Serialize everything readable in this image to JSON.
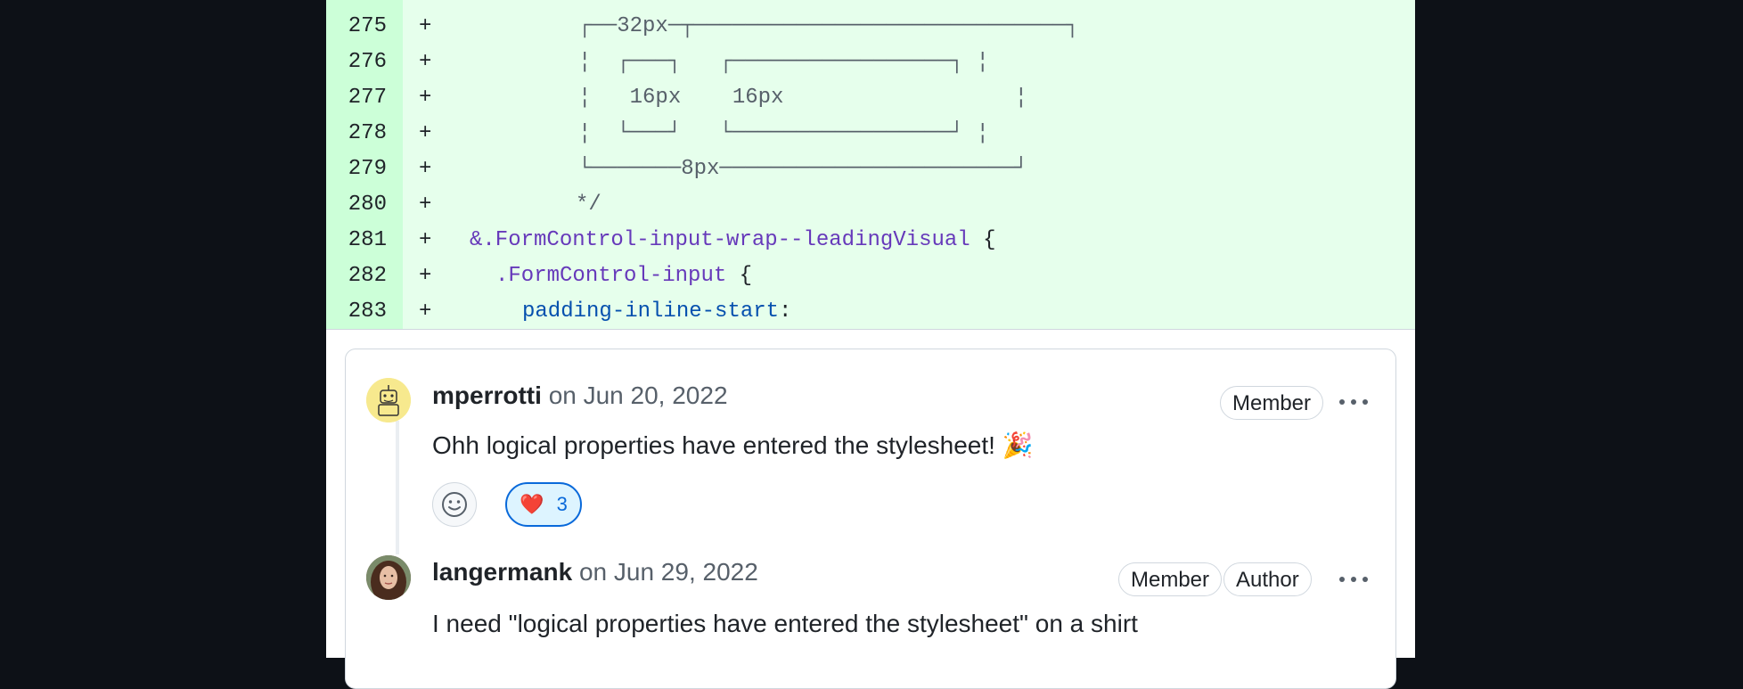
{
  "diff": {
    "lines": [
      {
        "num": "275",
        "sign": "+",
        "code": "┌──32px─┬─────────────────────────────┐"
      },
      {
        "num": "276",
        "sign": "+",
        "code": "¦  ┌───┐   ┌─────────────────┐ ¦"
      },
      {
        "num": "277",
        "sign": "+",
        "code": "¦   16px    16px                  ¦"
      },
      {
        "num": "278",
        "sign": "+",
        "code": "¦  └───┘   └─────────────────┘ ¦"
      },
      {
        "num": "279",
        "sign": "+",
        "code": "└───────8px───────────────────────┘"
      },
      {
        "num": "280",
        "sign": "+",
        "code": "*/"
      },
      {
        "num": "281",
        "sign": "+",
        "code_sel": "&.FormControl-input-wrap--leadingVisual",
        "code_pun": " {"
      },
      {
        "num": "282",
        "sign": "+",
        "code_sel": ".FormControl-input",
        "code_pun": " {"
      },
      {
        "num": "283",
        "sign": "+",
        "code_prop": "padding-inline-start",
        "code_pun": ":"
      }
    ]
  },
  "comments": [
    {
      "author": "mperrotti",
      "date": "on Jun 20, 2022",
      "badges": [
        "Member"
      ],
      "body": "Ohh logical properties have entered the stylesheet! 🎉",
      "reactions": [
        {
          "emoji": "❤️",
          "count": "3"
        }
      ]
    },
    {
      "author": "langermank",
      "date": "on Jun 29, 2022",
      "badges": [
        "Member",
        "Author"
      ],
      "body": "I need \"logical properties have entered the stylesheet\" on a shirt"
    }
  ],
  "colors": {
    "accent": "#0969da",
    "added_bg": "#e6ffec",
    "added_gutter": "#ccffd8"
  }
}
